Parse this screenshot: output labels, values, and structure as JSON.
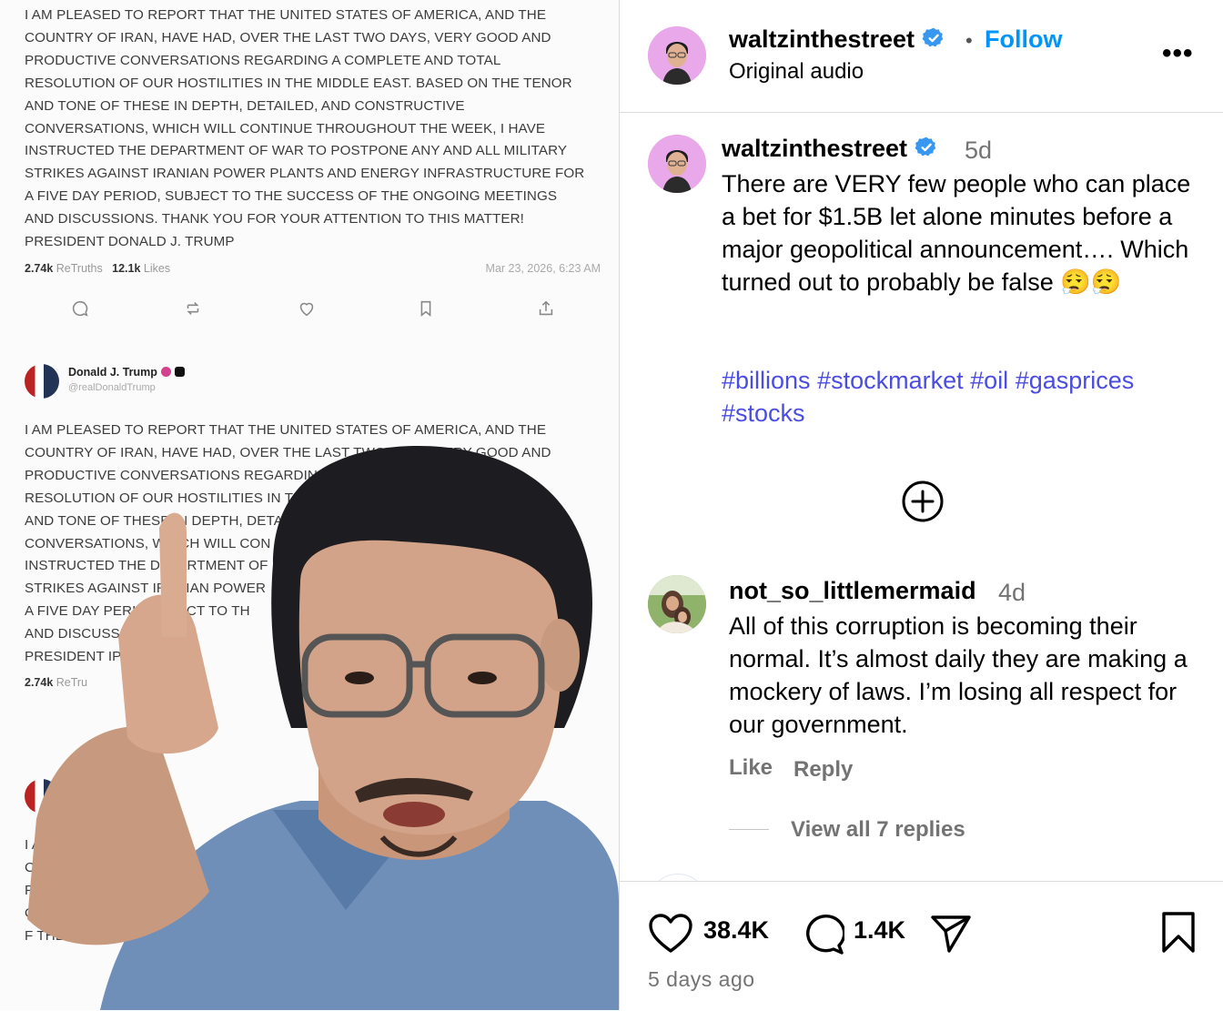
{
  "video": {
    "post1": {
      "text": "I AM PLEASED TO REPORT THAT THE UNITED STATES OF AMERICA, AND THE\nCOUNTRY OF IRAN, HAVE HAD, OVER THE LAST TWO DAYS, VERY GOOD AND\nPRODUCTIVE CONVERSATIONS REGARDING A COMPLETE AND TOTAL\nRESOLUTION OF OUR HOSTILITIES IN THE MIDDLE EAST. BASED ON THE TENOR\nAND TONE OF THESE IN DEPTH, DETAILED, AND CONSTRUCTIVE\nCONVERSATIONS, WHICH WILL CONTINUE THROUGHOUT THE WEEK, I HAVE\nINSTRUCTED THE DEPARTMENT OF WAR TO POSTPONE ANY AND ALL MILITARY\nSTRIKES AGAINST IRANIAN POWER PLANTS AND ENERGY INFRASTRUCTURE FOR\nA FIVE DAY PERIOD, SUBJECT TO THE SUCCESS OF THE ONGOING MEETINGS\nAND DISCUSSIONS. THANK YOU FOR YOUR ATTENTION TO THIS MATTER!\nPRESIDENT DONALD J. TRUMP",
      "retruths": "2.74k",
      "retruths_label": "ReTruths",
      "likes": "12.1k",
      "likes_label": "Likes",
      "date": "Mar 23, 2026, 6:23 AM"
    },
    "post2": {
      "author": "Donald J. Trump",
      "handle": "@realDonaldTrump",
      "text": "I AM PLEASED TO REPORT THAT THE UNITED STATES OF AMERICA, AND THE\nCOUNTRY OF IRAN, HAVE HAD, OVER THE LAST TWO DAYS, VERY GOOD AND\nPRODUCTIVE CONVERSATIONS REGARDING\nRESOLUTION OF OUR HOSTILITIES IN TH                                                            ENOR\nAND TONE OF THESE IN DEPTH, DETA\nCONVERSATIONS, WHICH WILL CON\nINSTRUCTED THE DEPARTMENT OF\nSTRIKES AGAINST IRANIAN POWER\nA FIVE DAY PERIO  UBJECT TO TH\nAND DISCUSSIO          YOU FO\nPRESIDENT                    IP",
      "retruths": "2.74k",
      "retruths_label": "ReTru"
    },
    "post3": {
      "text": "I AM        O REPORT T\nCO       RAN, HAV\nF         CONVER\n            OF OU\n              F THE"
    }
  },
  "header": {
    "username": "waltzinthestreet",
    "separator": "•",
    "follow_label": "Follow",
    "audio_label": "Original audio",
    "more_label": "•••"
  },
  "caption": {
    "username": "waltzinthestreet",
    "time": "5d",
    "body": "There are VERY few people who can place a bet for $1.5B let alone minutes before a major geopolitical announcement…. Which turned out to probably be false 😮‍💨😮‍💨",
    "hashtags": [
      "#billions",
      "#stockmarket",
      "#oil",
      "#gasprices",
      "#stocks"
    ]
  },
  "comment": {
    "username": "not_so_littlemermaid",
    "time": "4d",
    "body": "All of this corruption is becoming their normal. It’s almost daily they are making a mockery of laws. I’m losing all respect for our government.",
    "like_label": "Like",
    "reply_label": "Reply",
    "view_replies_label": "View all 7 replies"
  },
  "footer": {
    "likes": "38.4K",
    "comments": "1.4K",
    "posted": "5 days ago"
  },
  "colors": {
    "follow_blue": "#0095f6",
    "hashtag_blue": "#4a4de0",
    "verified_blue": "#3897f0",
    "muted_gray": "#737373"
  },
  "icons": [
    "verified-badge-icon",
    "more-options-icon",
    "load-more-comments-icon",
    "like-heart-icon",
    "comment-bubble-icon",
    "share-paper-plane-icon",
    "save-bookmark-icon",
    "reply-icon",
    "retruth-icon",
    "like-icon",
    "bookmark-icon",
    "upload-icon"
  ]
}
